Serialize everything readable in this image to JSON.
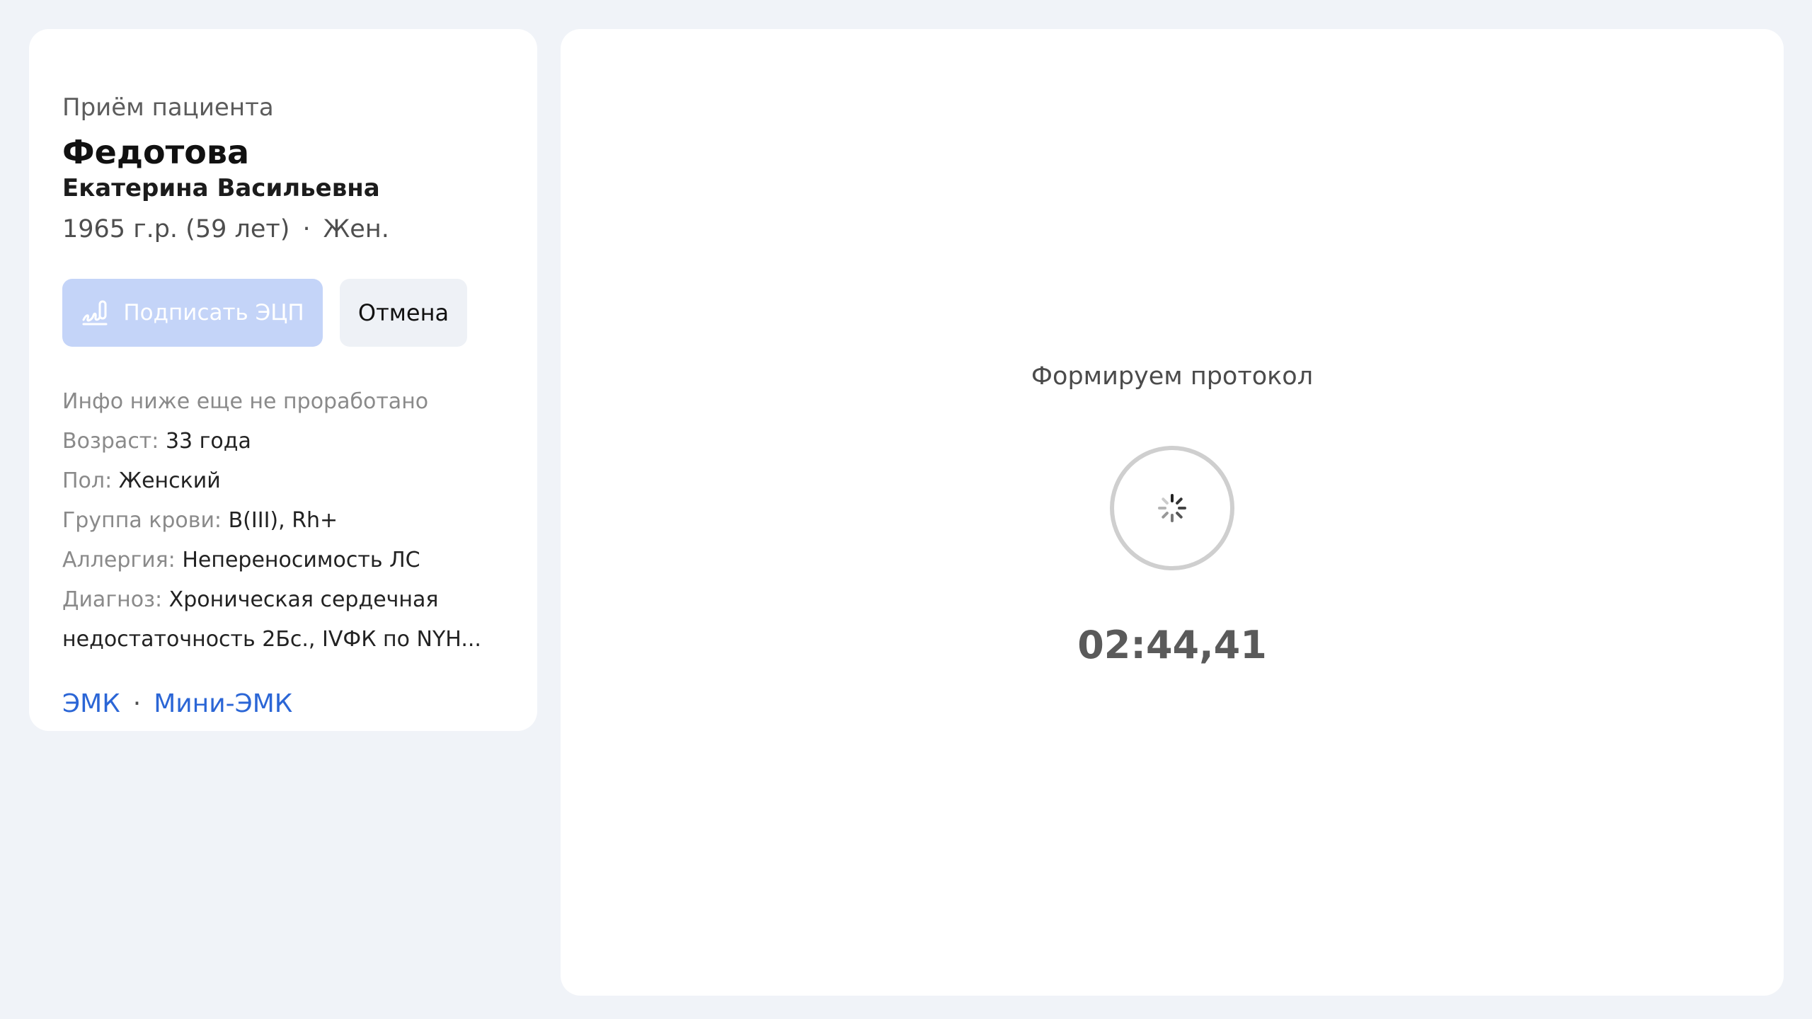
{
  "patient_card": {
    "subtitle": "Приём пациента",
    "last_name": "Федотова",
    "first_middle_name": "Екатерина Васильевна",
    "birth_info": "1965 г.р. (59 лет)",
    "separator": "·",
    "sex_short": "Жен.",
    "sign_button_label": "Подписать ЭЦП",
    "cancel_button_label": "Отмена",
    "info_note": "Инфо ниже еще не проработано",
    "info": {
      "age_label": "Возраст:",
      "age_value": "33 года",
      "sex_label": "Пол:",
      "sex_value": "Женский",
      "blood_label": "Группа крови:",
      "blood_value": "B(III), Rh+",
      "allergy_label": "Аллергия:",
      "allergy_value": "Непереносимость ЛС",
      "diagnosis_label": "Диагноз:",
      "diagnosis_value": "Хроническая сердечная недостаточность 2Бс., IVФК по NYH..."
    },
    "links": {
      "emk": "ЭМК",
      "mini_emk": "Мини-ЭМК"
    }
  },
  "main_panel": {
    "status_text": "Формируем протокол",
    "timer": "02:44,41"
  },
  "icons": {
    "sign": "signature-icon",
    "spinner": "loading-spinner-icon"
  },
  "colors": {
    "background": "#f0f3f8",
    "accent_link": "#2b66d6",
    "sign_button_disabled": "#c4d4f8",
    "cancel_button": "#eef1f6"
  }
}
